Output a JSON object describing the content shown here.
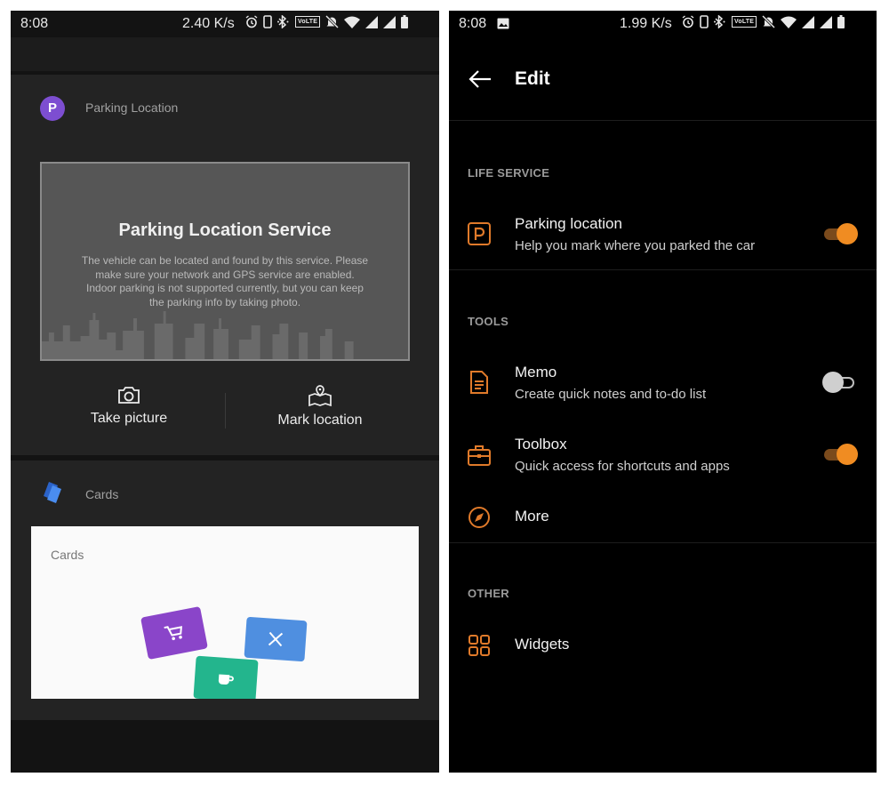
{
  "colors": {
    "accent": "#f08c22",
    "icon_orange": "#e07a2a",
    "parking_badge": "#7d4ed1",
    "shop_card": "#8a45c9",
    "dine_card": "#4f8fe0",
    "coffee_card": "#23b58d"
  },
  "left": {
    "status": {
      "time": "8:08",
      "speed": "2.40 K/s",
      "volte": "VoLTE"
    },
    "parking": {
      "badge_letter": "P",
      "header": "Parking Location",
      "service_title": "Parking Location Service",
      "service_desc": "The vehicle can be located and found by this service. Please make sure your network and GPS service are enabled. Indoor parking is not supported currently, but you can keep the parking info by taking photo.",
      "take_picture": "Take picture",
      "mark_location": "Mark location"
    },
    "cards": {
      "header": "Cards",
      "preview_label": "Cards"
    }
  },
  "right": {
    "status": {
      "time": "8:08",
      "speed": "1.99 K/s",
      "volte": "VoLTE"
    },
    "title": "Edit",
    "sections": {
      "life": "LIFE SERVICE",
      "tools": "TOOLS",
      "other": "OTHER"
    },
    "items": {
      "parking": {
        "title": "Parking location",
        "subtitle": "Help you mark where you parked the car",
        "enabled": true,
        "icon": "parking-icon"
      },
      "memo": {
        "title": "Memo",
        "subtitle": "Create quick notes and to-do list",
        "enabled": false,
        "icon": "memo-icon"
      },
      "toolbox": {
        "title": "Toolbox",
        "subtitle": "Quick access for shortcuts and apps",
        "enabled": true,
        "icon": "toolbox-icon"
      },
      "more": {
        "title": "More",
        "icon": "compass-icon"
      },
      "widgets": {
        "title": "Widgets",
        "icon": "widgets-icon"
      }
    }
  }
}
